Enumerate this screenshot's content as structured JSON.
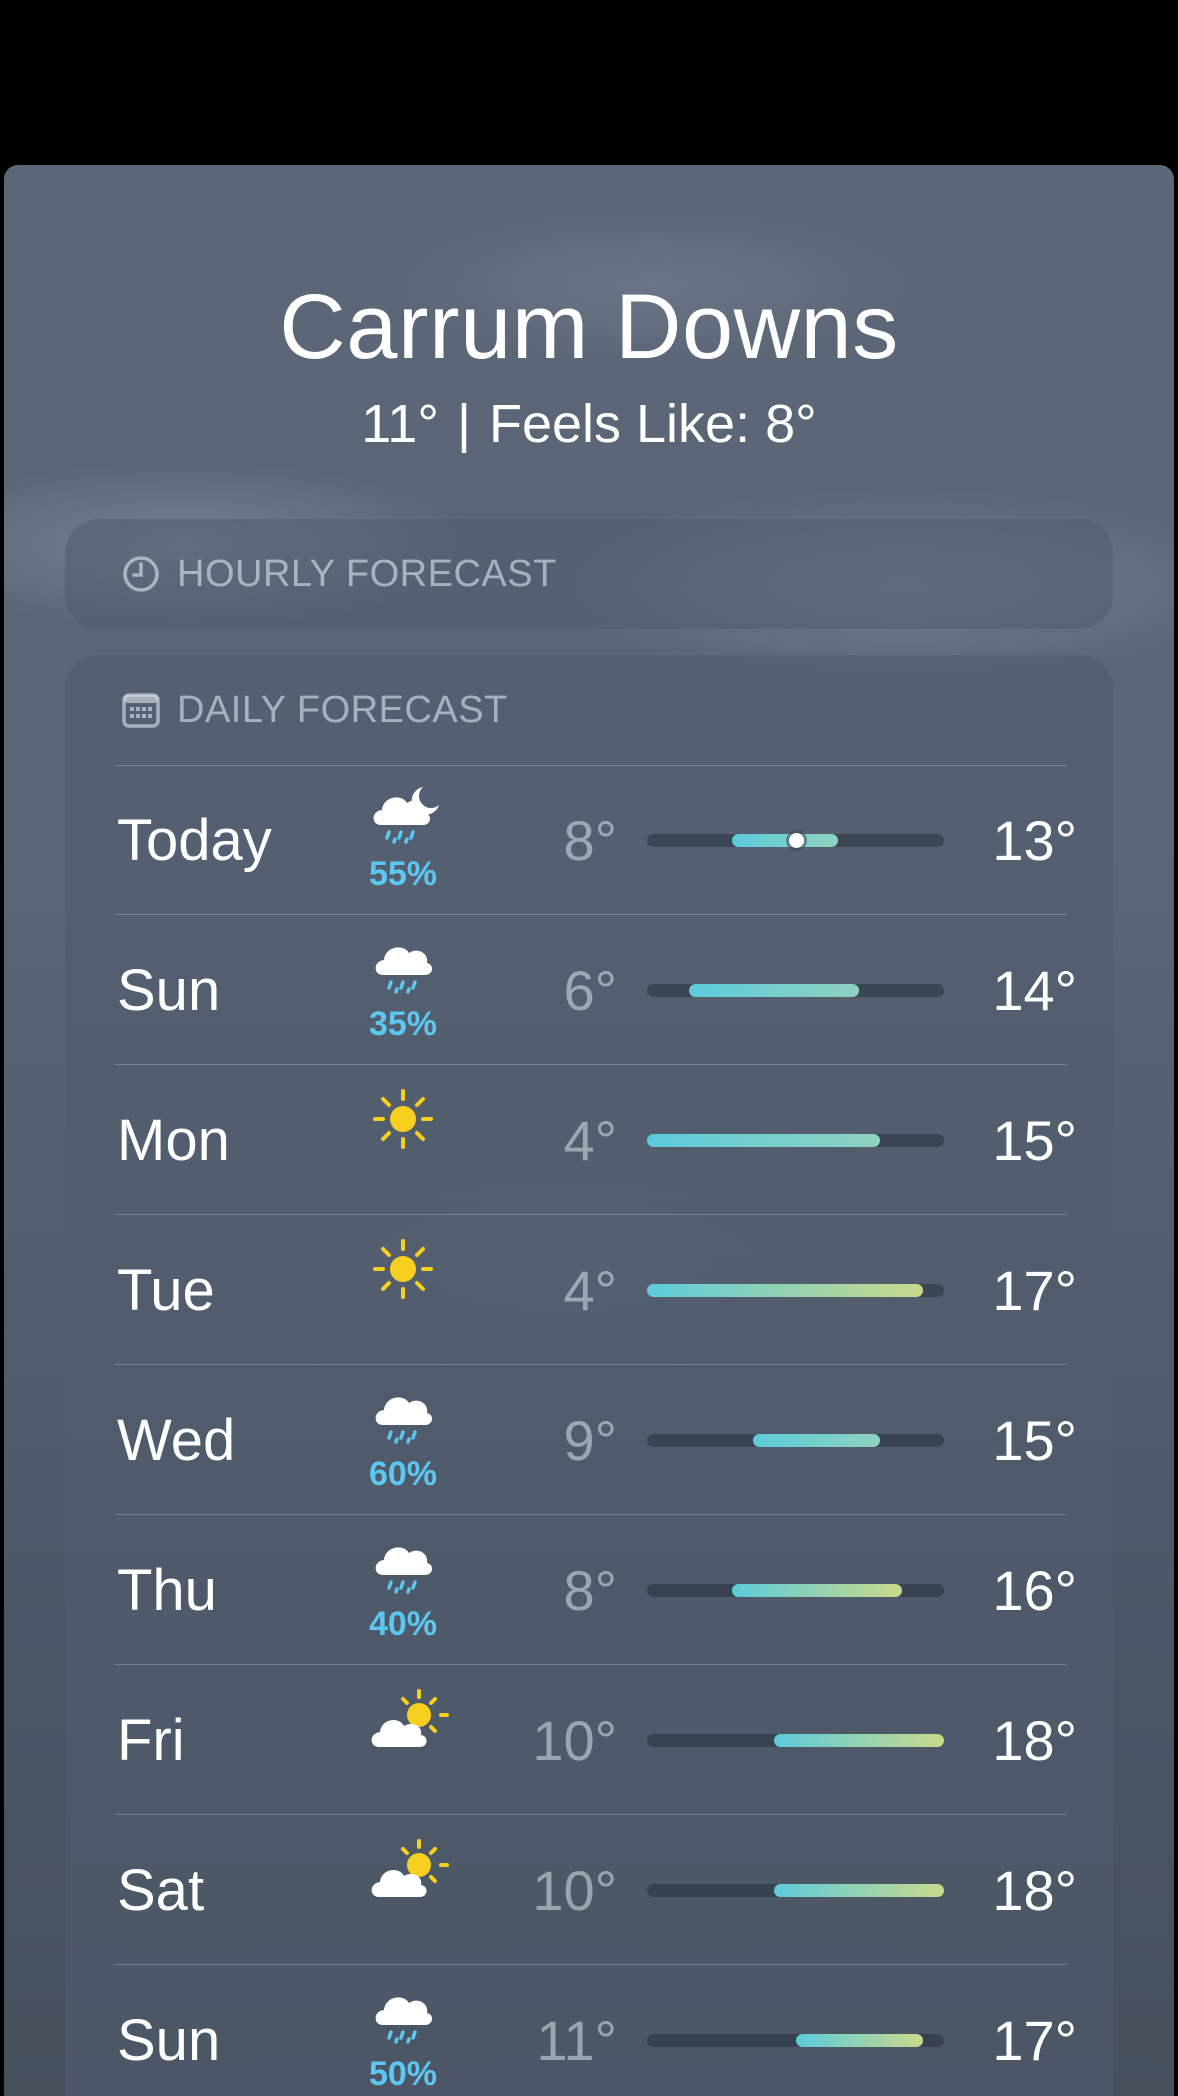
{
  "location": {
    "city": "Carrum Downs",
    "current_temp": "11°",
    "separator": "|",
    "feels_like": "Feels Like: 8°"
  },
  "hourly": {
    "title": "HOURLY FORECAST",
    "icon": "clock-icon"
  },
  "daily": {
    "title": "DAILY FORECAST",
    "icon": "calendar-icon",
    "range_min": 4,
    "range_max": 18,
    "colors": {
      "cool": "#5ccbdc",
      "mild": "#8fd2bf",
      "warm": "#c9d98a",
      "precip": "#5cc8f2"
    },
    "days": [
      {
        "day": "Today",
        "icon": "cloud-moon-rain-icon",
        "precip": "55%",
        "low": "8°",
        "high": "13°",
        "low_val": 8,
        "high_val": 13,
        "current_val": 11
      },
      {
        "day": "Sun",
        "icon": "cloud-rain-icon",
        "precip": "35%",
        "low": "6°",
        "high": "14°",
        "low_val": 6,
        "high_val": 14
      },
      {
        "day": "Mon",
        "icon": "sun-icon",
        "precip": "",
        "low": "4°",
        "high": "15°",
        "low_val": 4,
        "high_val": 15
      },
      {
        "day": "Tue",
        "icon": "sun-icon",
        "precip": "",
        "low": "4°",
        "high": "17°",
        "low_val": 4,
        "high_val": 17
      },
      {
        "day": "Wed",
        "icon": "cloud-rain-icon",
        "precip": "60%",
        "low": "9°",
        "high": "15°",
        "low_val": 9,
        "high_val": 15
      },
      {
        "day": "Thu",
        "icon": "cloud-rain-icon",
        "precip": "40%",
        "low": "8°",
        "high": "16°",
        "low_val": 8,
        "high_val": 16
      },
      {
        "day": "Fri",
        "icon": "cloud-sun-icon",
        "precip": "",
        "low": "10°",
        "high": "18°",
        "low_val": 10,
        "high_val": 18
      },
      {
        "day": "Sat",
        "icon": "cloud-sun-icon",
        "precip": "",
        "low": "10°",
        "high": "18°",
        "low_val": 10,
        "high_val": 18
      },
      {
        "day": "Sun",
        "icon": "cloud-rain-icon",
        "precip": "50%",
        "low": "11°",
        "high": "17°",
        "low_val": 11,
        "high_val": 17
      }
    ]
  }
}
